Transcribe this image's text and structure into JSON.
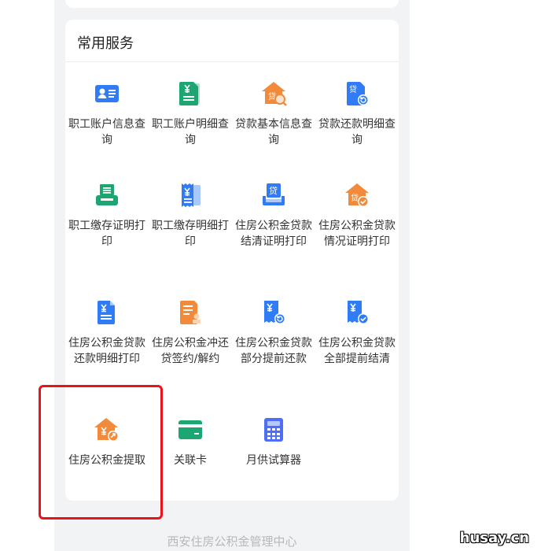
{
  "section_title": "常用服务",
  "services": [
    {
      "label": "职工账户信息查询",
      "icon": "id-card-icon",
      "color": "#2f7cf6"
    },
    {
      "label": "职工账户明细查询",
      "icon": "yuan-document-icon",
      "color": "#1ba672"
    },
    {
      "label": "贷款基本信息查询",
      "icon": "loan-house-search-icon",
      "color": "#f28a3c"
    },
    {
      "label": "贷款还款明细查询",
      "icon": "loan-document-refresh-icon",
      "color": "#2f7cf6"
    },
    {
      "label": "职工缴存证明打印",
      "icon": "printer-icon",
      "color": "#1ba672"
    },
    {
      "label": "职工缴存明细打印",
      "icon": "yuan-receipt-icon",
      "color": "#2f7cf6"
    },
    {
      "label": "住房公积金贷款结清证明打印",
      "icon": "loan-printer-icon",
      "color": "#2f7cf6"
    },
    {
      "label": "住房公积金贷款情况证明打印",
      "icon": "loan-house-check-icon",
      "color": "#f28a3c"
    },
    {
      "label": "住房公积金贷款还款明细打印",
      "icon": "yuan-document-list-icon",
      "color": "#2f7cf6"
    },
    {
      "label": "住房公积金冲还贷签约/解约",
      "icon": "document-stamp-icon",
      "color": "#f28a3c"
    },
    {
      "label": "住房公积金贷款部分提前还款",
      "icon": "yuan-receipt-refresh-icon",
      "color": "#2f7cf6"
    },
    {
      "label": "住房公积金贷款全部提前结清",
      "icon": "yuan-receipt-check-icon",
      "color": "#2f7cf6"
    },
    {
      "label": "住房公积金提取",
      "icon": "house-yuan-withdraw-icon",
      "color": "#f28a3c"
    },
    {
      "label": "关联卡",
      "icon": "bank-card-icon",
      "color": "#1ba672"
    },
    {
      "label": "月供试算器",
      "icon": "calculator-icon",
      "color": "#4f6ef7"
    }
  ],
  "footer": "西安住房公积金管理中心",
  "watermark": "husay.cn",
  "colors": {
    "highlight": "#e8141a",
    "background": "#f2f3f5"
  }
}
